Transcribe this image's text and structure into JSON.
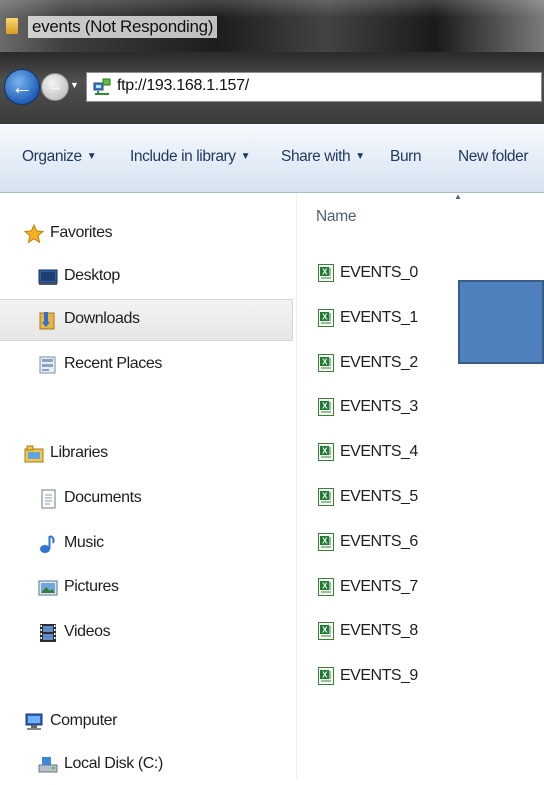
{
  "window": {
    "title": "events (Not Responding)"
  },
  "address": {
    "path": "ftp://193.168.1.157/"
  },
  "toolbar": {
    "organize": "Organize",
    "include_in_library": "Include in library",
    "share_with": "Share with",
    "burn": "Burn",
    "new_folder": "New folder"
  },
  "nav": {
    "favorites": "Favorites",
    "desktop": "Desktop",
    "downloads": "Downloads",
    "recent_places": "Recent Places",
    "libraries": "Libraries",
    "documents": "Documents",
    "music": "Music",
    "pictures": "Pictures",
    "videos": "Videos",
    "computer": "Computer",
    "local_disk": "Local Disk (C:)"
  },
  "content": {
    "column_name": "Name",
    "files": [
      "EVENTS_0",
      "EVENTS_1",
      "EVENTS_2",
      "EVENTS_3",
      "EVENTS_4",
      "EVENTS_5",
      "EVENTS_6",
      "EVENTS_7",
      "EVENTS_8",
      "EVENTS_9"
    ]
  },
  "colors": {
    "accent_blue": "#4f81bd",
    "excel_green": "#1f7a34",
    "selection": "#e6e6e6"
  }
}
